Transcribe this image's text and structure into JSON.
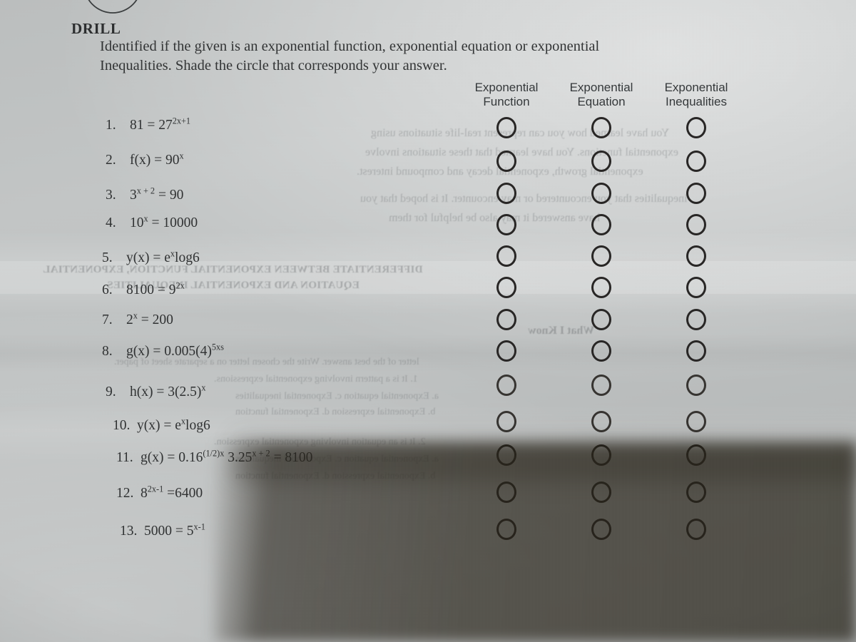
{
  "document": {
    "title": "DRILL",
    "instructions_line1": "Identified if the given is an exponential function, exponential equation or exponential",
    "instructions_line2": "Inequalities. Shade the circle that corresponds your answer."
  },
  "colors": {
    "paper": "#bfc2c2",
    "ink": "#2f3132",
    "bubble_stroke": "#272524",
    "shadow": "#2c281e"
  },
  "columns": [
    {
      "id": "exponential-function",
      "line1": "Exponential",
      "line2": "Function"
    },
    {
      "id": "exponential-equation",
      "line1": "Exponential",
      "line2": "Equation"
    },
    {
      "id": "exponential-inequalities",
      "line1": "Exponential",
      "line2": "Inequalities"
    }
  ],
  "questions": [
    {
      "number": "1.",
      "text_html": "81 = 27<sup>2x+1</sup>",
      "plain": "81 = 27^(2x+1)"
    },
    {
      "number": "2.",
      "text_html": "f(x) = 90<sup>x</sup>",
      "plain": "f(x) = 90^x"
    },
    {
      "number": "3.",
      "text_html": "3<sup>x + 2</sup> = 90",
      "plain": "3^(x+2) = 90"
    },
    {
      "number": "4.",
      "text_html": "10<sup>x</sup> = 10000",
      "plain": "10^x = 10000"
    },
    {
      "number": "5.",
      "text_html": "y(x) = e<sup>x</sup>log6",
      "plain": "y(x) = e^x log6"
    },
    {
      "number": "6.",
      "text_html": "8100 = 9<sup>2x</sup>",
      "plain": "8100 = 9^(2x)"
    },
    {
      "number": "7.",
      "text_html": "2<sup>x</sup> = 200",
      "plain": "2^x = 200"
    },
    {
      "number": "8.",
      "text_html": "g(x) = 0.005(4)<sup>5xs</sup>",
      "plain": "g(x) = 0.005(4)^(5xs)"
    },
    {
      "number": "9.",
      "text_html": "h(x) = 3(2.5)<sup>x</sup>",
      "plain": "h(x) = 3(2.5)^x"
    },
    {
      "number": "10.",
      "text_html": "y(x) = e<sup>x</sup>log6",
      "plain": "y(x) = e^x log6"
    },
    {
      "number": "11.",
      "text_html": "g(x) = 0.16<sup>(1/2)x</sup> 3.25<sup>x + 2</sup> = 8100",
      "plain": "g(x) = 0.16^((1/2)x) 3.25^(x+2) = 8100"
    },
    {
      "number": "12.",
      "text_html": "8<sup>2x-1</sup> =6400",
      "plain": "8^(2x-1) = 6400"
    },
    {
      "number": "13.",
      "text_html": "5000 = 5<sup>x-1</sup>",
      "plain": "5000 = 5^(x-1)"
    }
  ],
  "answer_grid": {
    "rows": 13,
    "columns": 3,
    "shaded": [],
    "note": "all bubbles are unshaded / empty outlines"
  },
  "bleed_through": [
    {
      "text": "You have learned how you can represent real-life situations using"
    },
    {
      "text": "exponential functions. You have learned that these situations involve"
    },
    {
      "text": "exponential growth, exponential decay and compound interest."
    },
    {
      "text": "inequalities that you encountered or may encounter. It is hoped that you"
    },
    {
      "text": "have answered it may also be helpful for them"
    },
    {
      "text": "DIFFERENTIATE BETWEEN EXPONENTIAL FUNCTION, EXPONENTIAL"
    },
    {
      "text": "EQUATION AND EXPONENTIAL INEQUALITIES"
    },
    {
      "text": "What I Know"
    },
    {
      "text": "letter of the best answer. Write the chosen letter on a separate sheet of paper."
    },
    {
      "text": "1. It is a pattern involving exponential expressions."
    },
    {
      "text": "a. Exponential equation          c. Exponential inequalities"
    },
    {
      "text": "b. Exponential expression        d. Exponential function"
    },
    {
      "text": "2. It is an equation involving exponential expression."
    },
    {
      "text": "a. Exponential equation          c. Exponential inequalities"
    },
    {
      "text": "b. Exponential expression        d. Exponential function"
    }
  ]
}
